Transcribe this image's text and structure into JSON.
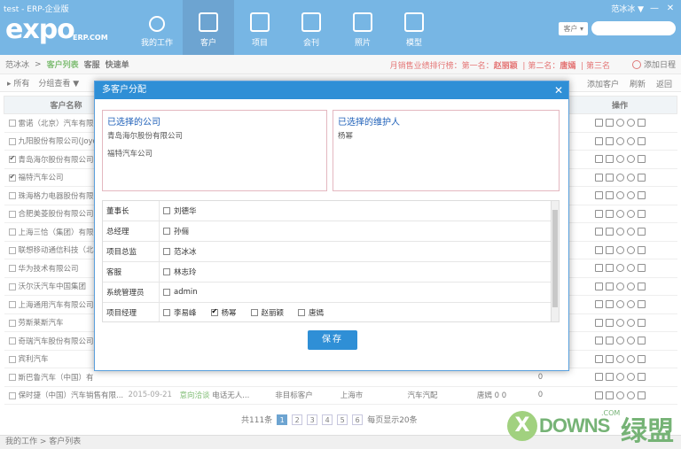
{
  "window": {
    "title": "test - ERP-企业版",
    "user": "范冰冰 ▼",
    "min": "—",
    "close": "✕"
  },
  "logo": {
    "main": "expo",
    "sub": "ERP.COM"
  },
  "nav": [
    {
      "label": "我的工作",
      "icon": "user-icon"
    },
    {
      "label": "客户",
      "icon": "bag-icon"
    },
    {
      "label": "项目",
      "icon": "folder-icon"
    },
    {
      "label": "会刊",
      "icon": "book-icon"
    },
    {
      "label": "照片",
      "icon": "photo-icon"
    },
    {
      "label": "模型",
      "icon": "box-icon"
    }
  ],
  "search": {
    "category": "客户 ▾"
  },
  "breadcrumb": {
    "user": "范冰冰",
    "sep": ">",
    "current": "客户列表",
    "link1": "客服",
    "link2": "快速单"
  },
  "rank": {
    "label": "月销售业绩排行榜：",
    "first": "第一名：",
    "first_name": "赵丽颖",
    "second": "第二名：",
    "second_name": "唐嫣",
    "third": "第三名"
  },
  "add_schedule": "添加日程",
  "toolbar": {
    "all": "▸ 所有",
    "group": "分组查看 ▼",
    "add_customer": "添加客户",
    "refresh": "刷新",
    "back": "返回"
  },
  "table": {
    "headers": [
      "客户名称",
      "",
      "",
      "",
      "",
      "",
      "",
      "失单",
      "操作"
    ],
    "rows": [
      {
        "name": "雷诺（北京）汽车有限",
        "checked": false,
        "lost": "0"
      },
      {
        "name": "九阳股份有限公司(Joyo",
        "checked": false,
        "lost": "0"
      },
      {
        "name": "青岛海尔股份有限公司",
        "checked": true,
        "lost": "0"
      },
      {
        "name": "福特汽车公司",
        "checked": true,
        "lost": "0"
      },
      {
        "name": "珠海格力电器股份有限",
        "checked": false,
        "lost": "0"
      },
      {
        "name": "合肥美菱股份有限公司",
        "checked": false,
        "lost": "1"
      },
      {
        "name": "上海三恰（集团）有限",
        "checked": false,
        "lost": "1"
      },
      {
        "name": "联想移动通信科技（北",
        "checked": false,
        "lost": "0"
      },
      {
        "name": "华为技术有限公司",
        "checked": false,
        "lost": "0"
      },
      {
        "name": "沃尔沃汽车中国集团",
        "checked": false,
        "lost": "0"
      },
      {
        "name": "上海通用汽车有限公司",
        "checked": false,
        "lost": "0"
      },
      {
        "name": "劳斯莱斯汽车",
        "checked": false,
        "lost": "0"
      },
      {
        "name": "奇瑞汽车股份有限公司",
        "checked": false,
        "lost": "0"
      },
      {
        "name": "宾利汽车",
        "checked": false,
        "lost": "0"
      },
      {
        "name": "斯巴鲁汽车（中国）有",
        "checked": false,
        "lost": "0"
      },
      {
        "name": "保时捷（中国）汽车销售有限...",
        "checked": false,
        "date": "2015-09-21",
        "intent": "意向洽谈",
        "note": "电话无人...",
        "type": "非目标客户",
        "city": "上海市",
        "industry": "汽车汽配",
        "owner": "唐嫣",
        "c1": "0",
        "c2": "0",
        "lost": "0"
      }
    ]
  },
  "pager": {
    "total": "共111条",
    "pages": [
      "1",
      "2",
      "3",
      "4",
      "5",
      "6"
    ],
    "per_page": "每页显示20条"
  },
  "status_bar": "我的工作 > 客户列表",
  "watermark": {
    "x": "X",
    "text": "DOWNS",
    "cn": "绿盟",
    "com": ".COM"
  },
  "modal": {
    "title": "多客户分配",
    "close": "✕",
    "companies_title": "已选择的公司",
    "companies": [
      "青岛海尔股份有限公司",
      "福特汽车公司"
    ],
    "maintainers_title": "已选择的维护人",
    "maintainers": [
      "杨幂"
    ],
    "roles": [
      {
        "role": "董事长",
        "users": [
          {
            "name": "刘德华",
            "checked": false
          }
        ]
      },
      {
        "role": "总经理",
        "users": [
          {
            "name": "孙俪",
            "checked": false
          }
        ]
      },
      {
        "role": "项目总监",
        "users": [
          {
            "name": "范冰冰",
            "checked": false
          }
        ]
      },
      {
        "role": "客服",
        "users": [
          {
            "name": "林志玲",
            "checked": false
          }
        ]
      },
      {
        "role": "系统管理员",
        "users": [
          {
            "name": "admin",
            "checked": false
          }
        ]
      },
      {
        "role": "项目经理",
        "users": [
          {
            "name": "李易峰",
            "checked": false
          },
          {
            "name": "杨幂",
            "checked": true
          },
          {
            "name": "赵丽颖",
            "checked": false
          },
          {
            "name": "唐嫣",
            "checked": false
          }
        ]
      }
    ],
    "save": "保存"
  }
}
